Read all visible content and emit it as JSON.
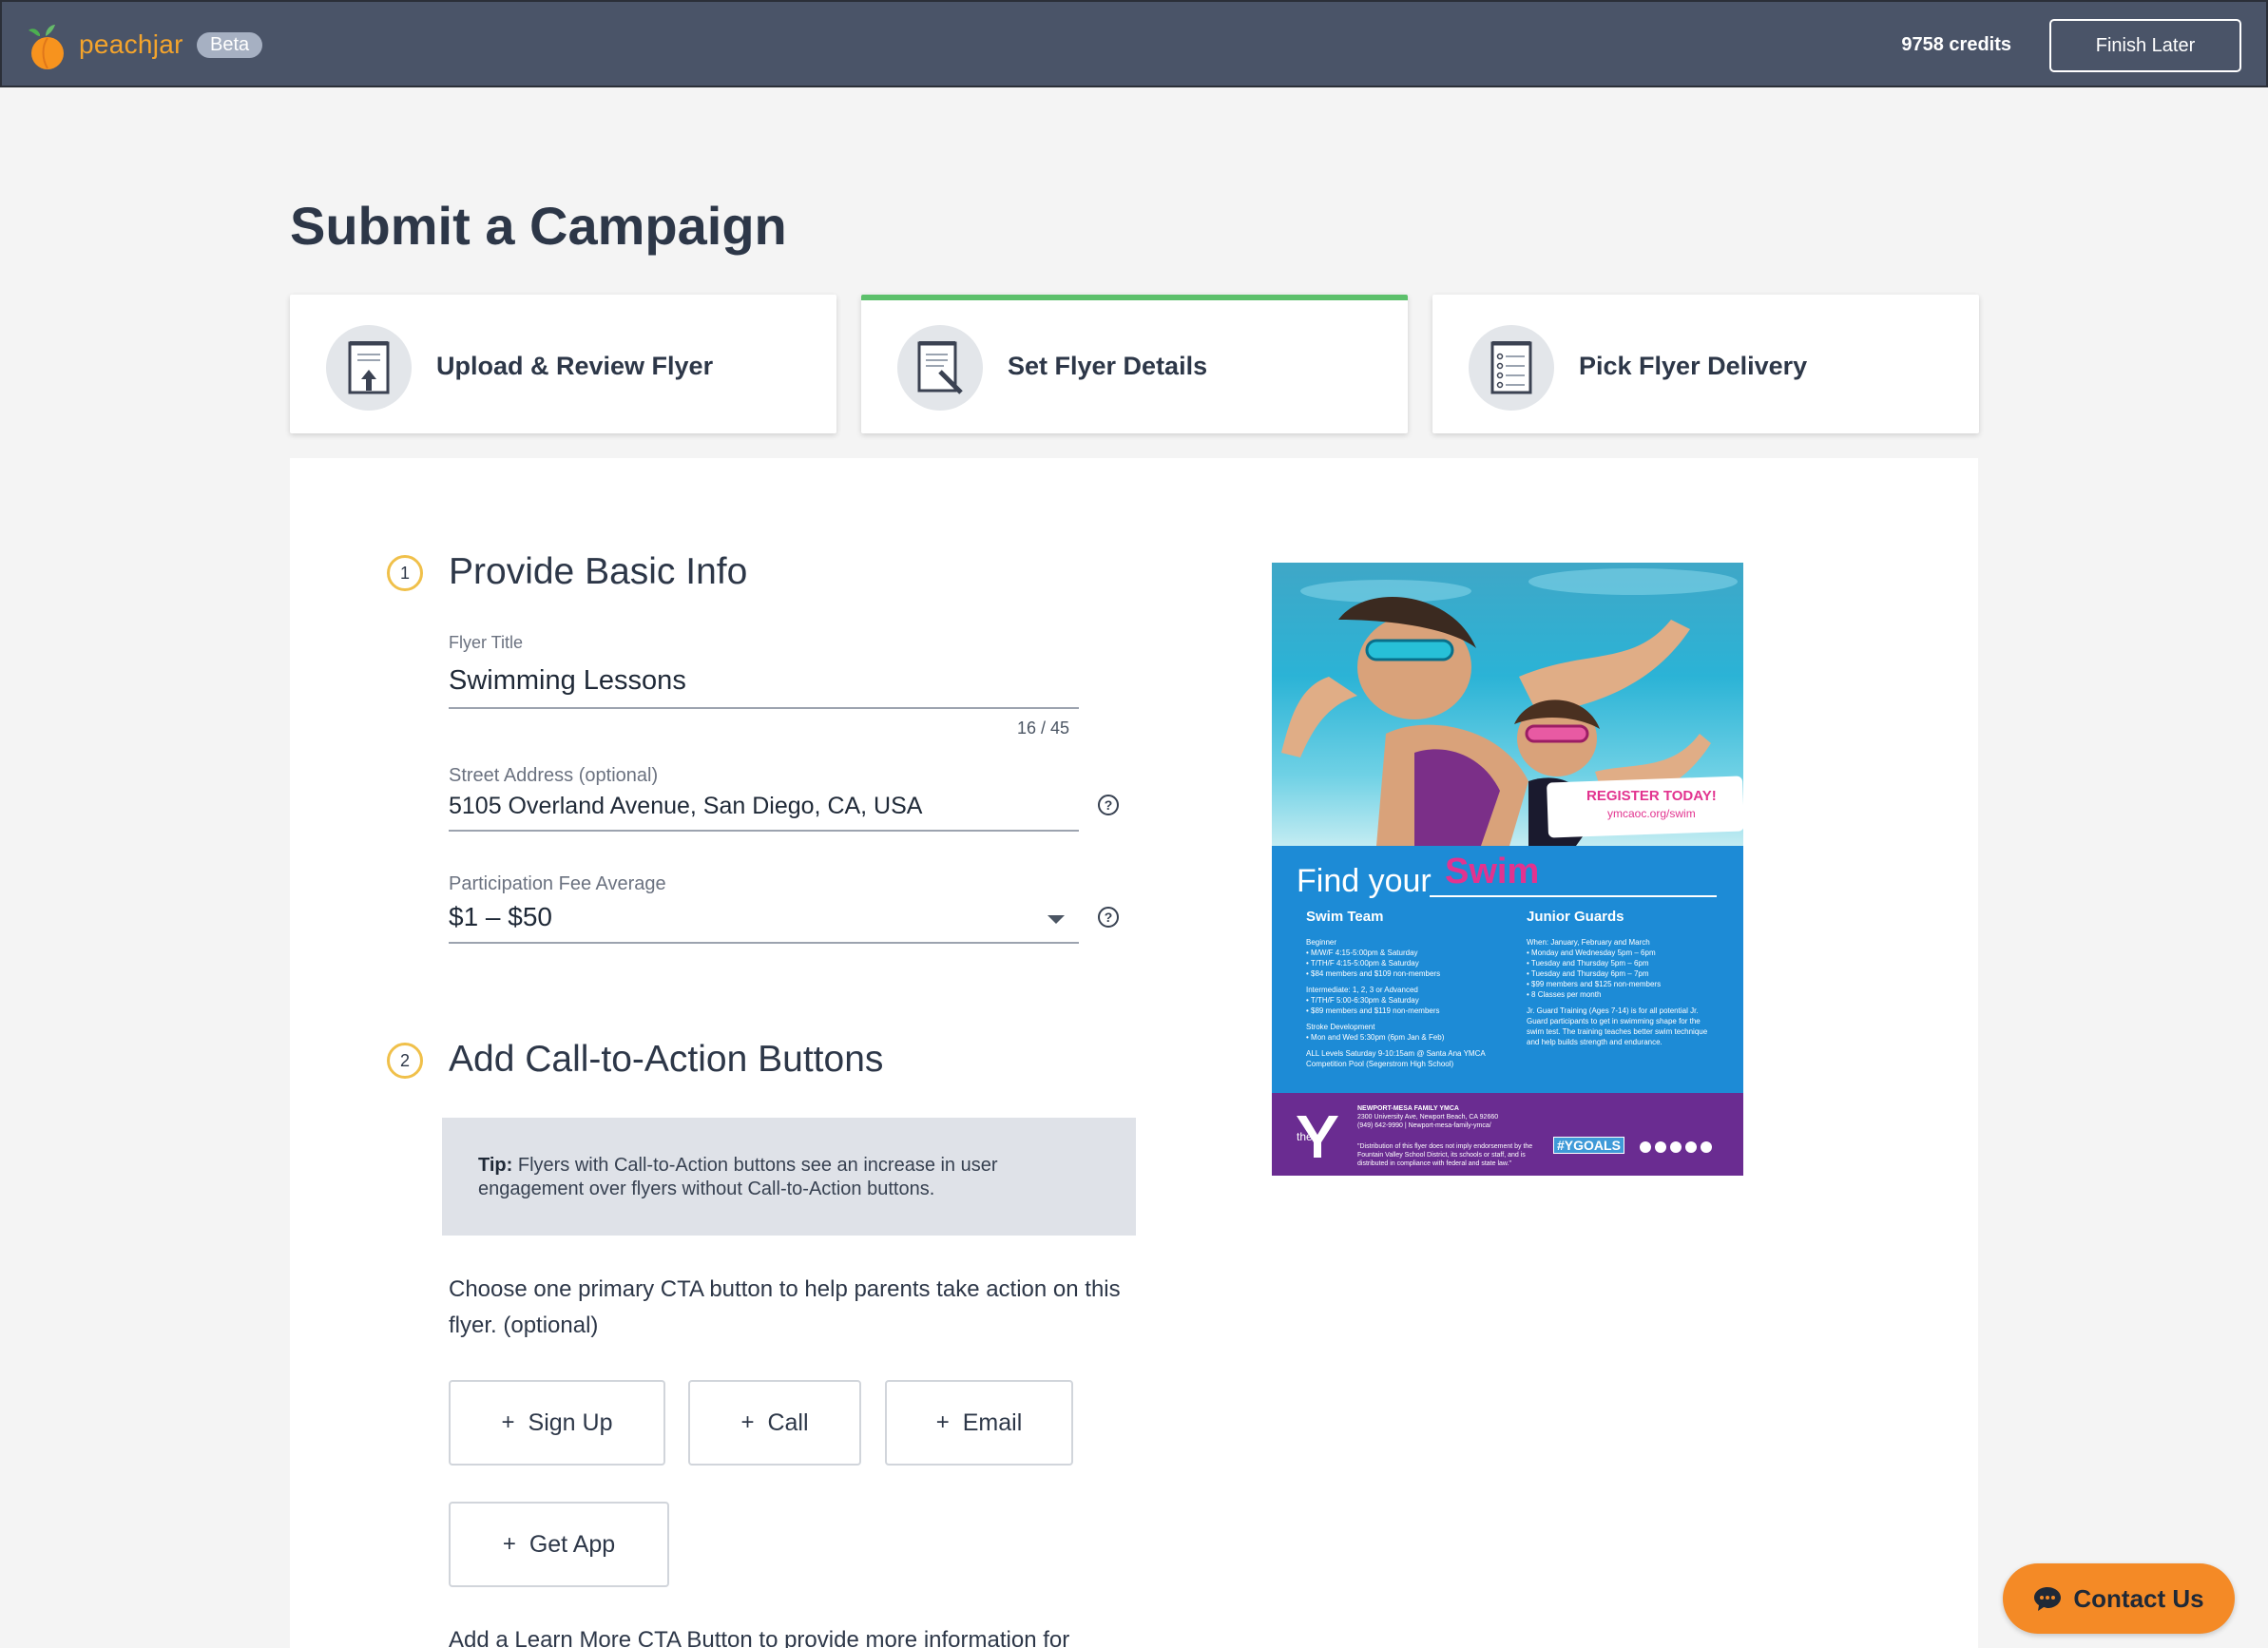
{
  "header": {
    "brand": "peachjar",
    "badge": "Beta",
    "credits": "9758 credits",
    "finish_label": "Finish Later"
  },
  "page_title": "Submit a Campaign",
  "steps": [
    {
      "label": "Upload & Review Flyer",
      "icon": "upload-document-icon",
      "active": false
    },
    {
      "label": "Set Flyer Details",
      "icon": "edit-document-icon",
      "active": true
    },
    {
      "label": "Pick Flyer Delivery",
      "icon": "checklist-icon",
      "active": false
    }
  ],
  "section1": {
    "number": "1",
    "title": "Provide Basic Info",
    "flyer_title": {
      "label": "Flyer Title",
      "value": "Swimming Lessons",
      "counter": "16 / 45"
    },
    "address": {
      "label": "Street Address (optional)",
      "value": "5105 Overland Avenue, San Diego, CA, USA"
    },
    "fee": {
      "label": "Participation Fee Average",
      "value": "$1 – $50"
    },
    "help_glyph": "?"
  },
  "section2": {
    "number": "2",
    "title": "Add Call-to-Action Buttons",
    "tip_bold": "Tip:",
    "tip_text": " Flyers with Call-to-Action buttons see an increase in user engagement over flyers without Call-to-Action buttons.",
    "description": "Choose one primary CTA button to help parents take action on this flyer. (optional)",
    "plus": "+",
    "buttons": [
      "Sign Up",
      "Call",
      "Email",
      "Get App"
    ],
    "learn_more": "Add a Learn More CTA Button to provide more information for"
  },
  "flyer": {
    "heading": "Find your",
    "heading_accent": "Swim",
    "col1_title": "Swim Team",
    "col2_title": "Junior Guards",
    "col1_lines": [
      "Beginner",
      "• M/W/F 4:15-5:00pm & Saturday",
      "• T/TH/F 4:15-5:00pm & Saturday",
      "• $84 members and $109 non-members",
      "",
      "Intermediate: 1, 2, 3 or Advanced",
      "• T/TH/F 5:00-6:30pm & Saturday",
      "• $89 members and $119 non-members",
      "",
      "Stroke Development",
      "• Mon and Wed 5:30pm (6pm Jan & Feb)",
      "",
      "ALL Levels Saturday 9-10:15am @ Santa Ana YMCA",
      "Competition Pool (Segerstrom High School)"
    ],
    "col2_lines": [
      "When: January, February and March",
      "• Monday and Wednesday 5pm – 6pm",
      "• Tuesday and Thursday 5pm – 6pm",
      "• Tuesday and Thursday 6pm – 7pm",
      "• $99 members and $125 non-members",
      "• 8 Classes per month",
      "",
      "Jr. Guard Training (Ages 7-14) is for all potential Jr.",
      "Guard participants to get in swimming shape for the",
      "swim test. The training teaches better swim technique",
      "and help builds strength and endurance."
    ],
    "register": "REGISTER TODAY!",
    "register_url": "ymcaoc.org/swim",
    "logo_word": "the",
    "org_lines": [
      "NEWPORT-MESA FAMILY YMCA",
      "2300 University Ave, Newport Beach, CA 92660",
      "(949) 642-9990 | Newport-mesa-family-ymca/"
    ],
    "disclaimer": [
      "\"Distribution of this flyer does not imply endorsement by the",
      "Fountain Valley School District, its schools or staff, and is",
      "distributed in compliance with federal and state law.\""
    ],
    "hashtag": "#YGOALS"
  },
  "contact_label": "Contact Us",
  "colors": {
    "topbar": "#4a5468",
    "accent_peach": "#f4a42c",
    "active_step": "#5cc06b",
    "section_ring": "#f0c04a",
    "contact": "#f48a26"
  }
}
